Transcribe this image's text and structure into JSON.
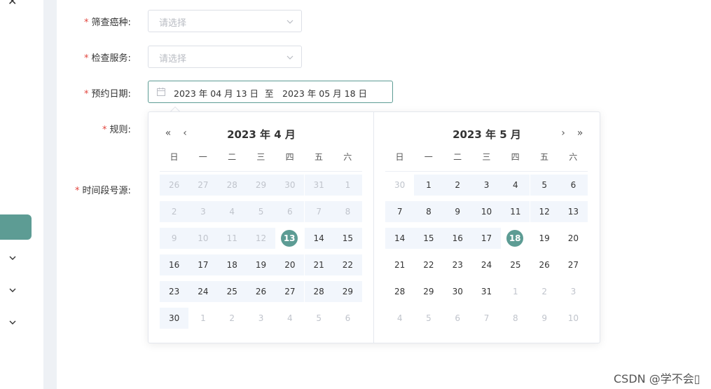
{
  "colors": {
    "accent": "#5d9c94",
    "range_bg": "#f2f6fc",
    "required": "#e2463f"
  },
  "sidebar": {
    "close_icon": "close-icon",
    "expand_icons": [
      "chevron-down-icon",
      "chevron-down-icon",
      "chevron-down-icon"
    ]
  },
  "form": {
    "required_mark": "*",
    "cancer_type": {
      "label": "筛查癌种:",
      "placeholder": "请选择"
    },
    "service": {
      "label": "检查服务:",
      "placeholder": "请选择"
    },
    "date": {
      "label": "预约日期:",
      "start": "2023 年 04 月 13 日",
      "separator": "至",
      "end": "2023 年 05 月 18 日"
    },
    "rules": {
      "label": "规则:"
    },
    "timeslots": {
      "label": "时间段号源:"
    }
  },
  "picker": {
    "weekdays": [
      "日",
      "一",
      "二",
      "三",
      "四",
      "五",
      "六"
    ],
    "left": {
      "title": "2023 年 4 月",
      "rows": [
        [
          "26",
          "27",
          "28",
          "29",
          "30",
          "31",
          "1"
        ],
        [
          "2",
          "3",
          "4",
          "5",
          "6",
          "7",
          "8"
        ],
        [
          "9",
          "10",
          "11",
          "12",
          "13",
          "14",
          "15"
        ],
        [
          "16",
          "17",
          "18",
          "19",
          "20",
          "21",
          "22"
        ],
        [
          "23",
          "24",
          "25",
          "26",
          "27",
          "28",
          "29"
        ],
        [
          "30",
          "1",
          "2",
          "3",
          "4",
          "5",
          "6"
        ]
      ]
    },
    "right": {
      "title": "2023 年 5 月",
      "rows": [
        [
          "30",
          "1",
          "2",
          "3",
          "4",
          "5",
          "6"
        ],
        [
          "7",
          "8",
          "9",
          "10",
          "11",
          "12",
          "13"
        ],
        [
          "14",
          "15",
          "16",
          "17",
          "18",
          "19",
          "20"
        ],
        [
          "21",
          "22",
          "23",
          "24",
          "25",
          "26",
          "27"
        ],
        [
          "28",
          "29",
          "30",
          "31",
          "1",
          "2",
          "3"
        ],
        [
          "4",
          "5",
          "6",
          "7",
          "8",
          "9",
          "10"
        ]
      ]
    }
  },
  "watermark": "CSDN @学不会▯"
}
